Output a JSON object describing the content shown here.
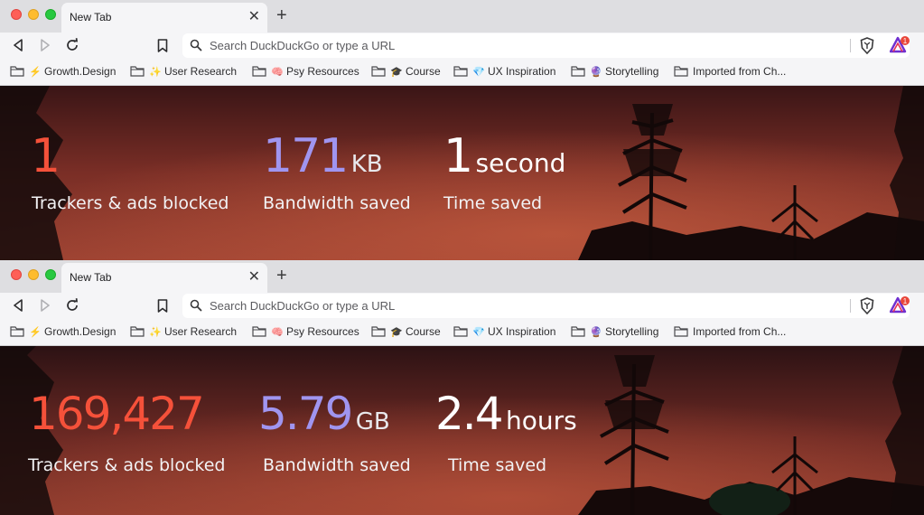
{
  "browsers": [
    {
      "tab_title": "New Tab",
      "url_placeholder": "Search DuckDuckGo or type a URL",
      "rewards_badge": "1",
      "stats": {
        "trackers_value": "1",
        "trackers_label": "Trackers & ads blocked",
        "bandwidth_value": "171",
        "bandwidth_unit": "KB",
        "bandwidth_label": "Bandwidth saved",
        "time_value": "1",
        "time_unit": "second",
        "time_label": "Time saved"
      }
    },
    {
      "tab_title": "New Tab",
      "url_placeholder": "Search DuckDuckGo or type a URL",
      "rewards_badge": "1",
      "stats": {
        "trackers_value": "169,427",
        "trackers_label": "Trackers & ads blocked",
        "bandwidth_value": "5.79",
        "bandwidth_unit": "GB",
        "bandwidth_label": "Bandwidth saved",
        "time_value": "2.4",
        "time_unit": "hours",
        "time_label": "Time saved"
      }
    }
  ],
  "bookmarks": [
    {
      "emoji": "⚡",
      "label": "Growth.Design"
    },
    {
      "emoji": "✨",
      "label": "User Research"
    },
    {
      "emoji": "🧠",
      "label": "Psy Resources"
    },
    {
      "emoji": "🎓",
      "label": "Course"
    },
    {
      "emoji": "💎",
      "label": "UX Inspiration"
    },
    {
      "emoji": "🔮",
      "label": "Storytelling"
    },
    {
      "emoji": "",
      "label": "Imported from Ch..."
    }
  ],
  "colors": {
    "trackers": "#f5513a",
    "bandwidth": "#a095f0",
    "time": "#ffffff",
    "tab_bar": "#dedee1",
    "toolbar": "#f5f5f7"
  },
  "icons": [
    "back-icon",
    "forward-icon",
    "reload-icon",
    "bookmark-icon",
    "search-icon",
    "brave-shield-icon",
    "brave-rewards-icon",
    "folder-icon",
    "close-icon",
    "plus-icon"
  ]
}
